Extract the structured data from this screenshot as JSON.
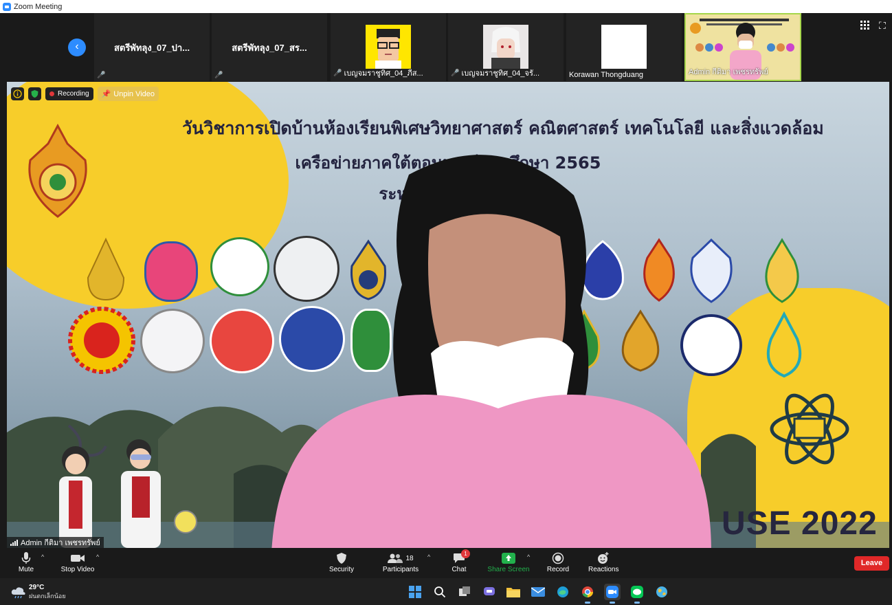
{
  "window": {
    "title": "Zoom Meeting"
  },
  "strip": {
    "tiles": [
      {
        "display_name": "สตรีพัทลุง_07_ปา...",
        "label": ""
      },
      {
        "display_name": "สตรีพัทลุง_07_สร...",
        "label": ""
      },
      {
        "display_name": "",
        "label": "เบญจมราชูทิศ_04_ภีส..."
      },
      {
        "display_name": "",
        "label": "เบญจมราชูทิศ_04_จรั..."
      },
      {
        "display_name": "",
        "label": "Korawan Thongduang"
      },
      {
        "display_name": "",
        "label": "Admin กีติมา เพชรทรัพย์"
      }
    ]
  },
  "video": {
    "recording_label": "Recording",
    "unpin_label": "Unpin Video",
    "banner": {
      "line1": "วันวิชาการเปิดบ้านห้องเรียนพิเศษวิทยาศาสตร์ คณิตศาสตร์ เทคโนโลยี และสิ่งแวดล้อม",
      "line2": "เครือข่ายภาคใต้ตอนบน ปีการศึกษา 2565",
      "line3": "ระหว่างวันที่ 2565"
    },
    "event_mark": "USE 2022",
    "speaker_name": "Admin กีติมา เพชรทรัพย์"
  },
  "toolbar": {
    "mute": "Mute",
    "stop_video": "Stop Video",
    "security": "Security",
    "participants": "Participants",
    "participants_count": "18",
    "chat": "Chat",
    "chat_badge": "1",
    "share_screen": "Share Screen",
    "record": "Record",
    "reactions": "Reactions",
    "leave": "Leave"
  },
  "taskbar": {
    "temperature": "29°C",
    "weather": "ฝนตกเล็กน้อย"
  },
  "colors": {
    "share_green": "#22b14c",
    "leave_red": "#e02828",
    "accent_blue": "#2d8cff",
    "banner_yellow": "#f7cd2a"
  }
}
